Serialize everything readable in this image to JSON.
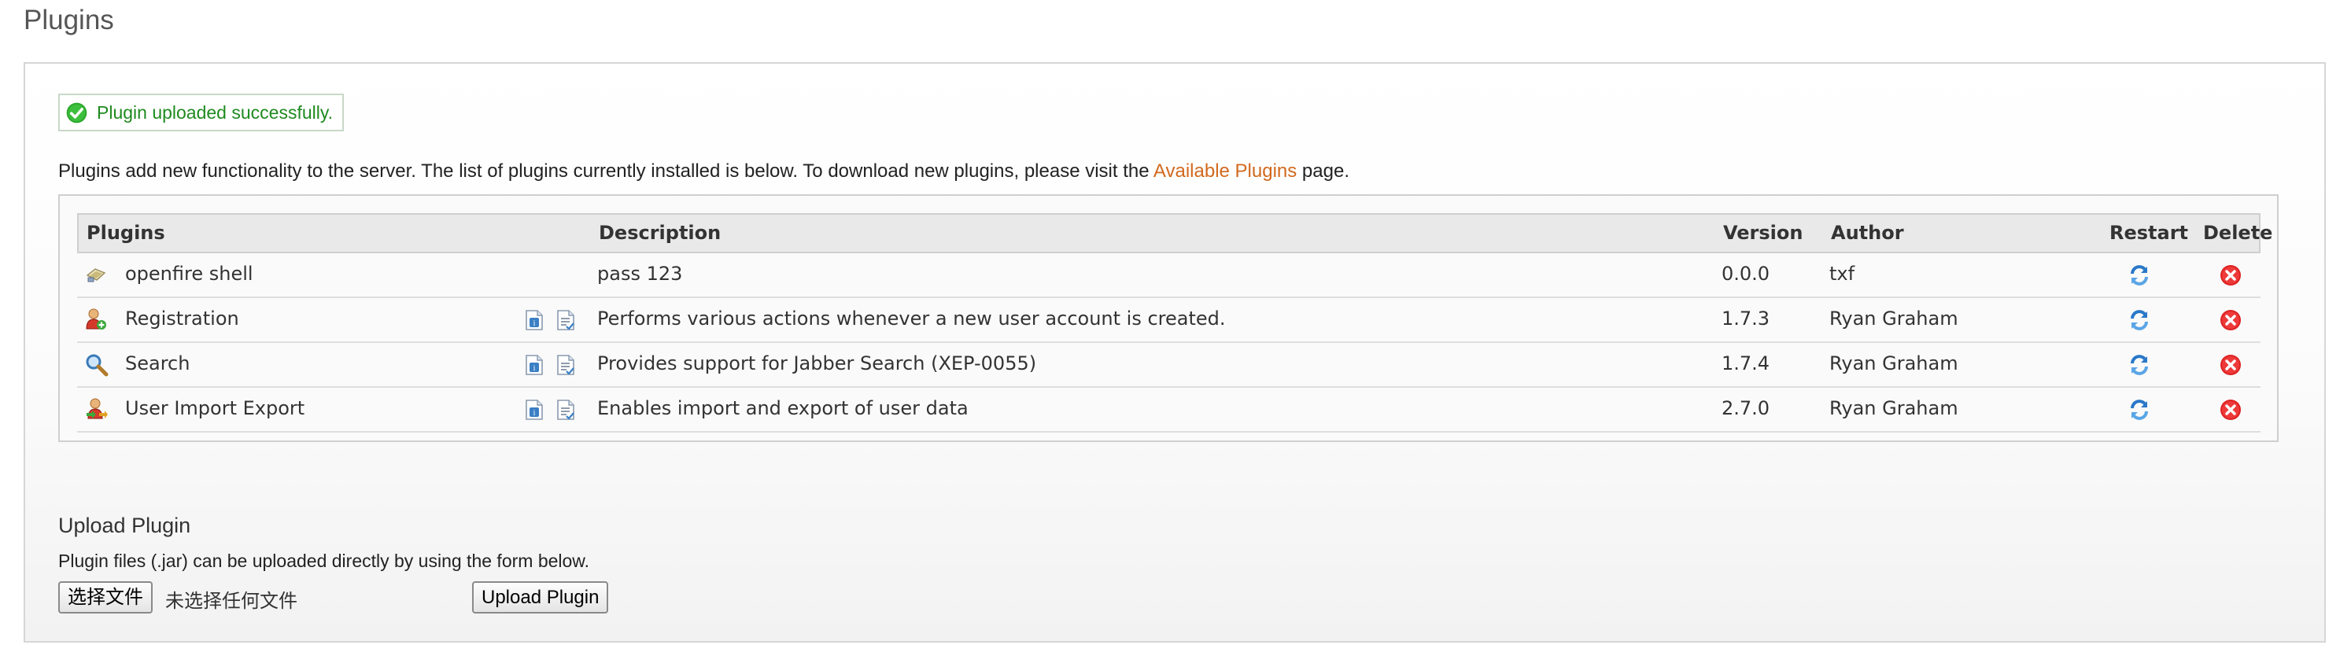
{
  "page": {
    "title": "Plugins"
  },
  "alert": {
    "message": "Plugin uploaded successfully."
  },
  "intro": {
    "text_before": "Plugins add new functionality to the server. The list of plugins currently installed is below. To download new plugins, please visit the ",
    "link": "Available Plugins",
    "text_after": " page."
  },
  "table": {
    "headers": [
      "Plugins",
      "Description",
      "Version",
      "Author",
      "Restart",
      "Delete"
    ],
    "rows": [
      {
        "name": "openfire shell",
        "description": "pass 123",
        "version": "0.0.0",
        "author": "txf",
        "icon": "plugin-icon",
        "has_docs": false
      },
      {
        "name": "Registration",
        "description": "Performs various actions whenever a new user account is created.",
        "version": "1.7.3",
        "author": "Ryan Graham",
        "icon": "user-add-icon",
        "has_docs": true
      },
      {
        "name": "Search",
        "description": "Provides support for Jabber Search (XEP-0055)",
        "version": "1.7.4",
        "author": "Ryan Graham",
        "icon": "magnifier-icon",
        "has_docs": true
      },
      {
        "name": "User Import Export",
        "description": "Enables import and export of user data",
        "version": "2.7.0",
        "author": "Ryan Graham",
        "icon": "user-import-icon",
        "has_docs": true
      }
    ]
  },
  "upload": {
    "title": "Upload Plugin",
    "description": "Plugin files (.jar) can be uploaded directly by using the form below.",
    "choose_file_label": "选择文件",
    "no_file_text": "未选择任何文件",
    "submit_label": "Upload Plugin"
  },
  "colors": {
    "link": "#d2691e",
    "success": "#1f8a1f",
    "delete": "#dd2222",
    "restart": "#2a78c8"
  }
}
